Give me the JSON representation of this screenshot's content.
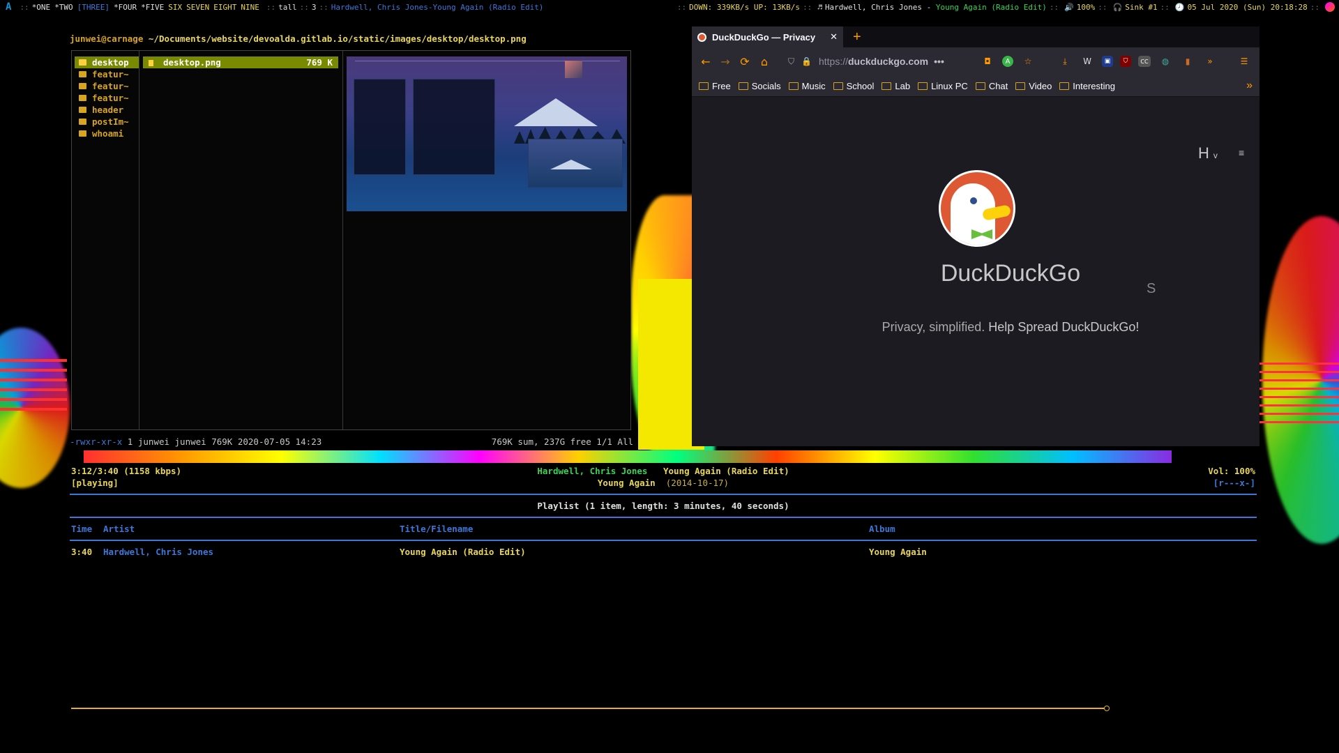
{
  "topbar": {
    "workspaces": [
      {
        "label": "*ONE",
        "state": "occupied"
      },
      {
        "label": "*TWO",
        "state": "occupied"
      },
      {
        "label": "[THREE]",
        "state": "active"
      },
      {
        "label": "*FOUR",
        "state": "occupied"
      },
      {
        "label": "*FIVE",
        "state": "occupied"
      },
      {
        "label": "SIX",
        "state": "empty"
      },
      {
        "label": "SEVEN",
        "state": "empty"
      },
      {
        "label": "EIGHT",
        "state": "empty"
      },
      {
        "label": "NINE",
        "state": "empty"
      }
    ],
    "separator": "::",
    "layout": "tall",
    "window_count": "3",
    "window_title": "Hardwell, Chris Jones-Young Again (Radio Edit)",
    "net": "DOWN: 339KB/s UP: 13KB/s",
    "song_prefix": "Hardwell, Chris Jones - ",
    "song_highlight": "Young Again (Radio Edit)",
    "volume": "100%",
    "sink": "Sink #1",
    "datetime": "05 Jul 2020 (Sun) 20:18:28",
    "note_icon": "♬",
    "speaker_icon": "🔊",
    "headphone_icon": "🎧",
    "clock_icon": "🕗"
  },
  "ranger": {
    "path_user": "junwei@carnage",
    "path": "~/Documents/website/devoalda.gitlab.io/static/images/desktop/desktop.png",
    "folders": [
      "desktop",
      "featur~",
      "featur~",
      "featur~",
      "header",
      "postIm~",
      "whoami"
    ],
    "selected_folder": "desktop",
    "file_name": "desktop.png",
    "file_size": "769 K",
    "status_perm": "-rwxr-xr-x",
    "status_info": "1 junwei junwei 769K 2020-07-05 14:23",
    "status_right": "769K sum, 237G free  1/1  All"
  },
  "firefox": {
    "tab_title": "DuckDuckGo — Privacy",
    "tab_close": "✕",
    "new_tab": "+",
    "url_proto": "https://",
    "url_domain": "duckduckgo.com",
    "url_more": "•••",
    "bookmarks": [
      "Free",
      "Socials",
      "Music",
      "School",
      "Lab",
      "Linux PC",
      "Chat",
      "Video",
      "Interesting"
    ],
    "bookmarks_more": "»",
    "nav": {
      "back": "←",
      "forward": "→",
      "reload": "⟳",
      "home": "⌂"
    },
    "extensions": [
      {
        "name": "pocket",
        "glyph": "◘"
      },
      {
        "name": "adblock",
        "glyph": "A"
      },
      {
        "name": "star",
        "glyph": "☆"
      },
      {
        "name": "download",
        "glyph": "⤓"
      },
      {
        "name": "wordpress",
        "glyph": "W"
      },
      {
        "name": "ext-shield",
        "glyph": "▣"
      },
      {
        "name": "ublock",
        "glyph": "⛉"
      },
      {
        "name": "cc",
        "glyph": "CC"
      },
      {
        "name": "globe",
        "glyph": "◍"
      },
      {
        "name": "trash",
        "glyph": "▮"
      },
      {
        "name": "overflow",
        "glyph": "»"
      },
      {
        "name": "menu",
        "glyph": "☰"
      }
    ],
    "page": {
      "header_letter": "H",
      "header_caret": "v",
      "menu_glyph": "≡",
      "brand": "DuckDuckGo",
      "search_letter": "S",
      "tagline_plain": "Privacy, simplified. ",
      "tagline_link": "Help Spread DuckDuckGo!"
    }
  },
  "cmus": {
    "position": "3:12/3:40 (1158 kbps)",
    "state": "[playing]",
    "artist": "Hardwell, Chris Jones",
    "title": "Young Again (Radio Edit)",
    "album": "Young Again",
    "date": "(2014-10-17)",
    "volume": "Vol: 100%",
    "flags": "[r---x-]",
    "playlist_title": "Playlist (1 item, length: 3 minutes, 40 seconds)",
    "columns": [
      "Time",
      "Artist",
      "Title/Filename",
      "Album"
    ],
    "tracks": [
      {
        "time": "3:40",
        "artist": "Hardwell, Chris Jones",
        "title": "Young Again (Radio Edit)",
        "album": "Young Again"
      }
    ],
    "progress_fraction": 1.0
  },
  "colors": {
    "accent_blue": "#3c78d8",
    "accent_yellow": "#e8d65a",
    "accent_green": "#39d353",
    "firefox_orange": "#ff9a00",
    "ddg_red": "#de5833"
  }
}
